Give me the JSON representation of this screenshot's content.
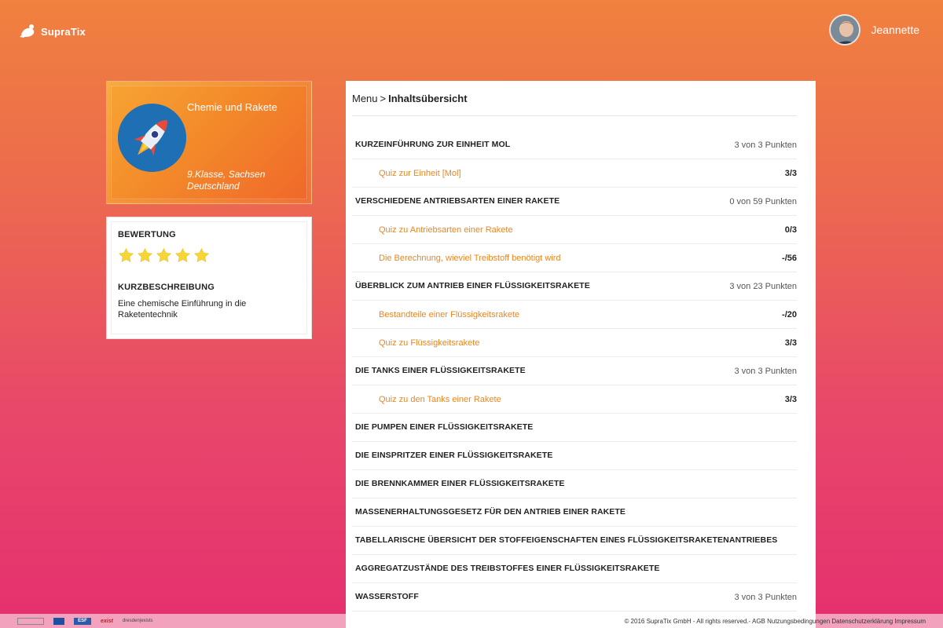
{
  "brand": {
    "name": "SupraTix"
  },
  "user": {
    "name": "Jeannette"
  },
  "course": {
    "title": "Chemie und Rakete",
    "grade_region": "9.Klasse, Sachsen",
    "country": "Deutschland"
  },
  "info": {
    "rating_title": "BEWERTUNG",
    "rating": 5,
    "rating_max": 5,
    "description_title": "KURZBESCHREIBUNG",
    "description": "Eine chemische Einführung in die Raketentechnik"
  },
  "breadcrumb": {
    "root": "Menu",
    "separator": ">",
    "current": "Inhaltsübersicht"
  },
  "toc": [
    {
      "type": "chapter",
      "label": "KURZEINFÜHRUNG ZUR EINHEIT MOL",
      "points": "3 von 3 Punkten"
    },
    {
      "type": "item",
      "label": "Quiz zur Einheit [Mol]",
      "points": "3/3"
    },
    {
      "type": "chapter",
      "label": "VERSCHIEDENE ANTRIEBSARTEN EINER RAKETE",
      "points": "0 von 59 Punkten"
    },
    {
      "type": "item",
      "label": "Quiz zu Antriebsarten einer Rakete",
      "points": "0/3"
    },
    {
      "type": "item",
      "label": "Die Berechnung, wieviel Treibstoff benötigt wird",
      "points": "-/56"
    },
    {
      "type": "chapter",
      "label": "ÜBERBLICK ZUM ANTRIEB EINER FLÜSSIGKEITSRAKETE",
      "points": "3 von 23 Punkten"
    },
    {
      "type": "item",
      "label": "Bestandteile einer Flüssigkeitsrakete",
      "points": "-/20"
    },
    {
      "type": "item",
      "label": "Quiz zu Flüssigkeitsrakete",
      "points": "3/3"
    },
    {
      "type": "chapter",
      "label": "DIE TANKS EINER FLÜSSIGKEITSRAKETE",
      "points": "3 von 3 Punkten"
    },
    {
      "type": "item",
      "label": "Quiz zu den Tanks einer Rakete",
      "points": "3/3"
    },
    {
      "type": "chapter",
      "label": "DIE PUMPEN EINER FLÜSSIGKEITSRAKETE",
      "points": ""
    },
    {
      "type": "chapter",
      "label": "DIE EINSPRITZER EINER FLÜSSIGKEITSRAKETE",
      "points": ""
    },
    {
      "type": "chapter",
      "label": "DIE BRENNKAMMER EINER FLÜSSIGKEITSRAKETE",
      "points": ""
    },
    {
      "type": "chapter",
      "label": "MASSENERHALTUNGSGESETZ FÜR DEN ANTRIEB EINER RAKETE",
      "points": ""
    },
    {
      "type": "chapter",
      "label": "TABELLARISCHE ÜBERSICHT DER STOFFEIGENSCHAFTEN EINES FLÜSSIGKEITSRAKETENANTRIEBES",
      "points": ""
    },
    {
      "type": "chapter",
      "label": "AGGREGATZUSTÄNDE DES TREIBSTOFFES EINER FLÜSSIGKEITSRAKETE",
      "points": ""
    },
    {
      "type": "chapter",
      "label": "WASSERSTOFF",
      "points": "3 von 3 Punkten"
    }
  ],
  "footer": {
    "copyright": "© 2016 SupraTix GmbH - All rights reserved.- AGB Nutzungsbedingungen Datenschutzerklärung Impressum",
    "logo_esf": "ESF",
    "logo_exist": "exist",
    "logo_dresden": "dresden|exists"
  },
  "colors": {
    "accent_orange": "#e8861f",
    "star": "#f5d538",
    "logo_blue": "#1e6fb4"
  },
  "icons": [
    "supratix-logo-icon",
    "star-icon",
    "rocket-icon",
    "avatar"
  ]
}
